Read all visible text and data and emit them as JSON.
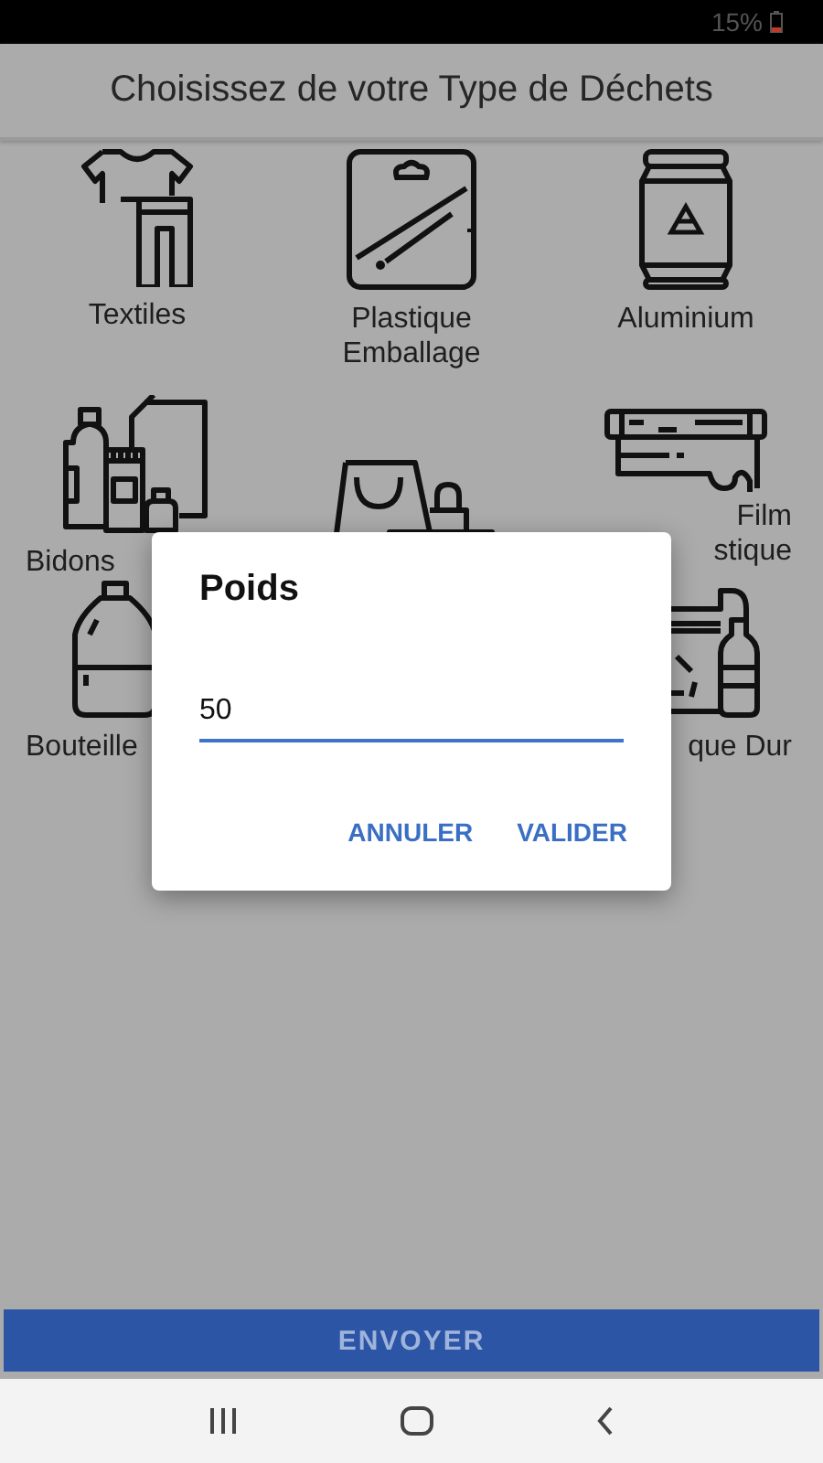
{
  "status_bar": {
    "battery_text": "15%"
  },
  "header": {
    "title": "Choisissez de votre Type de Déchets"
  },
  "rows": [
    {
      "cells": [
        {
          "label_lines": [
            "Textiles"
          ]
        },
        {
          "label_lines": [
            "Plastique",
            "Emballage"
          ]
        },
        {
          "label_lines": [
            "Aluminium"
          ]
        }
      ]
    },
    {
      "cells": [
        {
          "label_lines": [
            "Bidons"
          ]
        },
        {},
        {
          "label_lines": [
            "Film",
            "stique"
          ]
        }
      ]
    },
    {
      "cells": [
        {
          "label_lines": [
            "Bouteille"
          ]
        },
        {
          "label_lines": [
            "que Dur"
          ]
        }
      ]
    }
  ],
  "dialog": {
    "title": "Poids",
    "value": "50",
    "buttons": [
      "ANNULER",
      "VALIDER"
    ]
  },
  "send_button": "ENVOYER"
}
